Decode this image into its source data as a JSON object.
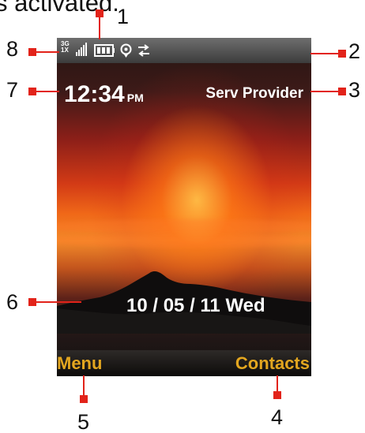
{
  "caption": {
    "text": "s activated."
  },
  "callouts": {
    "c1": "1",
    "c2": "2",
    "c3": "3",
    "c4": "4",
    "c5": "5",
    "c6": "6",
    "c7": "7",
    "c8": "8"
  },
  "status_bar": {
    "network_3g": "3G",
    "network_1x": "1X",
    "signal_icon": "signal-strength-icon",
    "battery_icon": "battery-icon",
    "location_icon": "location-icon",
    "data_icon": "data-transfer-icon"
  },
  "clock": {
    "time": "12:34",
    "ampm": "PM"
  },
  "provider": {
    "name": "Serv Provider"
  },
  "date": {
    "text": "10 / 05 / 11 Wed"
  },
  "softkeys": {
    "left": "Menu",
    "right": "Contacts"
  },
  "colors": {
    "callout_marker": "#e2231a",
    "softkey_text": "#e3a61f"
  }
}
